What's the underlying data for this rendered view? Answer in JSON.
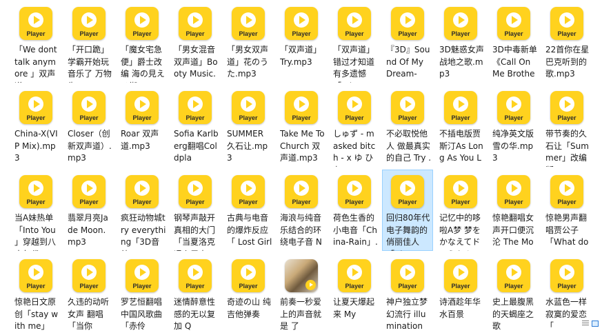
{
  "player_label": "Player",
  "colors": {
    "icon_bg": "#ffd21e",
    "selection_bg": "#cce8ff",
    "selection_border": "#99d1ff"
  },
  "files": [
    {
      "name": "「We dont talk anymore 」双声道"
    },
    {
      "name": "「开口跪」学霸开始玩音乐了 万物生.mp3"
    },
    {
      "name": "「魔女宅急便」爵士改编 海の見える街.mp3"
    },
    {
      "name": "「男女混音双声道」Booty Music.mp3"
    },
    {
      "name": "「男女双声道」花のうた.mp3"
    },
    {
      "name": "「双声道」Try.mp3"
    },
    {
      "name": "「双声道」错过才知道有多遗憾「What A"
    },
    {
      "name": "『3D』Sound Of My Dream-"
    },
    {
      "name": "3D魅惑女声战地之歌.mp3"
    },
    {
      "name": "3D中毒新单《Call On Me Brother"
    },
    {
      "name": "22首你在星巴克听到的歌.mp3"
    },
    {
      "name": "China-X(VIP Mix).mp3"
    },
    {
      "name": "Closer（创新双声道）.mp3"
    },
    {
      "name": "Roar 双声道.mp3"
    },
    {
      "name": "Sofia Karlberg翻唱Coldpla"
    },
    {
      "name": "SUMMER 久石让.mp3"
    },
    {
      "name": "Take Me To Church 双声道.mp3"
    },
    {
      "name": "しゅず - masked bitch - x ゆ ひ 左"
    },
    {
      "name": "不必取悦他人 做最真实的自己 Try .mp3"
    },
    {
      "name": "不插电版贾斯汀As Long As You Lov"
    },
    {
      "name": "纯净英文版雪の华.mp3"
    },
    {
      "name": "带节奏的久石让「Summer」改编版.m"
    },
    {
      "name": "当A妹热单「Into You 」穿越到八十年代.m"
    },
    {
      "name": "翡翠月亮Jade Moon.mp3"
    },
    {
      "name": "疯狂动物城try everything「3D音效"
    },
    {
      "name": "钢琴声敲开真相的大门「当夏洛克遇上周杰"
    },
    {
      "name": "古典与电音的爆炸反应「 Lost Girls」"
    },
    {
      "name": "海浪与纯音乐结合的环绕电子音 Neptune"
    },
    {
      "name": "荷色生香的小电音「China-Rain」.mp3"
    },
    {
      "name": "回归80年代电子舞韵的俏丽佳人「Alone Ag"
    },
    {
      "name": "记忆中的哆啦A梦 梦をかなえてドラえもん"
    },
    {
      "name": "惊艳翻唱女声开口便沉沦 The Monster"
    },
    {
      "name": "惊艳男声翻唱贾公子「What do you mea"
    },
    {
      "name": "惊艳日文原创「stay with me」"
    },
    {
      "name": "久违的动听女声 翻唱「当你"
    },
    {
      "name": "罗艺恒翻唱中国风歌曲「赤伶"
    },
    {
      "name": "迷情醉意性感的无以复加 Q"
    },
    {
      "name": "奇迹の山 纯吉他弹奏"
    },
    {
      "name": "前奏一秒爱上的声音就是 了"
    },
    {
      "name": "让夏天爆起来 My"
    },
    {
      "name": "神户独立梦幻流行 illumination"
    },
    {
      "name": "诗酒趁年华 水百景"
    },
    {
      "name": "史上最腹黑的天蝎座之歌"
    },
    {
      "name": "水蓝色一样寂寞的爱恋「"
    }
  ]
}
